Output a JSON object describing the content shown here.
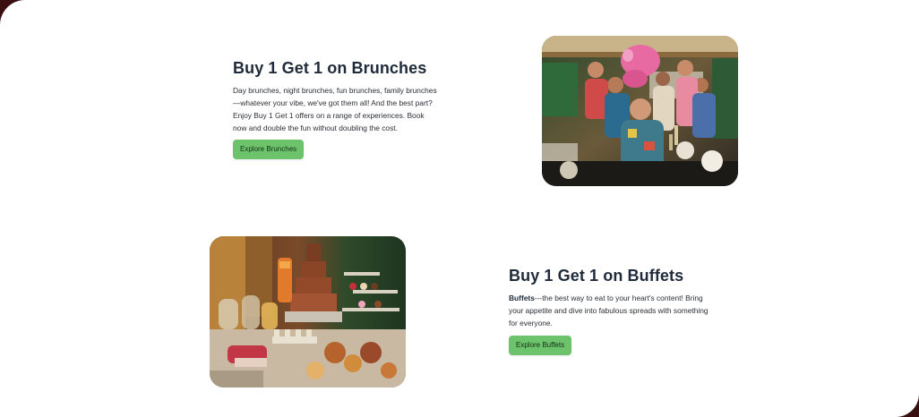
{
  "brunches": {
    "title": "Buy 1 Get 1 on Brunches",
    "description": "Day brunches, night brunches, fun brunches, family brunches—whatever your vibe, we've got them all! And the best part? Enjoy Buy 1 Get 1 offers on a range of experiences. Book now and double the fun without doubling the cost.",
    "button_label": "Explore Brunches",
    "image_icon": "brunch-party-photo"
  },
  "buffets": {
    "title": "Buy 1 Get 1 on Buffets",
    "description_bold": "Buffets",
    "description_rest": "---the best way to eat to your heart's content! Bring your appetite and dive into fabulous spreads with something for everyone.",
    "button_label": "Explore Buffets",
    "image_icon": "dessert-buffet-photo"
  },
  "colors": {
    "accent_button": "#6cc36b",
    "heading": "#1f2a3a",
    "frame": "#3a0f12"
  }
}
